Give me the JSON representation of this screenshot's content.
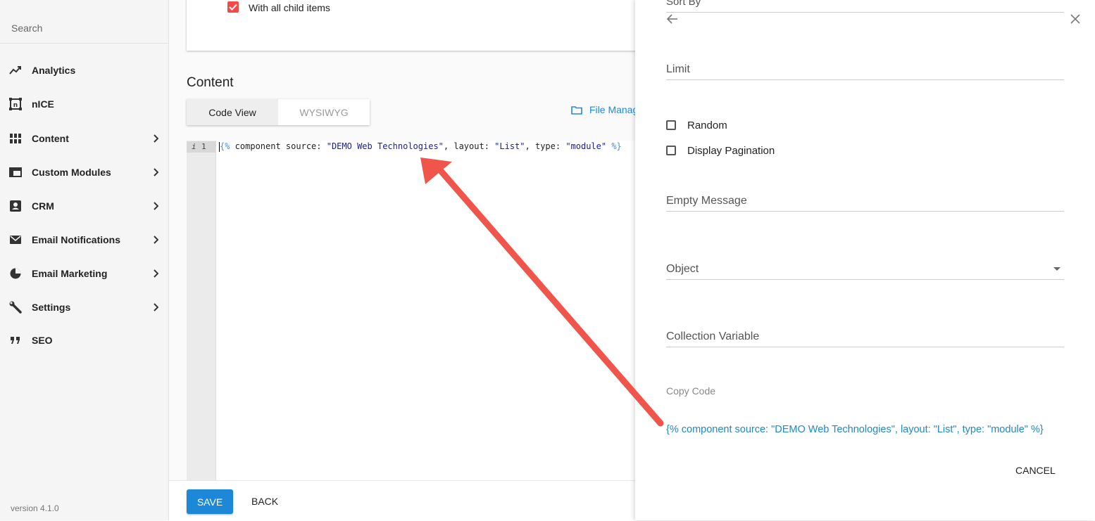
{
  "sidebar": {
    "search_placeholder": "Search",
    "items": [
      {
        "label": "Analytics",
        "icon": "trending-up-icon",
        "has_chevron": false
      },
      {
        "label": "nICE",
        "icon": "nice-icon",
        "has_chevron": false
      },
      {
        "label": "Content",
        "icon": "grid-icon",
        "has_chevron": true
      },
      {
        "label": "Custom Modules",
        "icon": "modules-icon",
        "has_chevron": true
      },
      {
        "label": "CRM",
        "icon": "contact-card-icon",
        "has_chevron": true
      },
      {
        "label": "Email Notifications",
        "icon": "envelope-icon",
        "has_chevron": true
      },
      {
        "label": "Email Marketing",
        "icon": "pie-chart-icon",
        "has_chevron": true
      },
      {
        "label": "Settings",
        "icon": "wrench-icon",
        "has_chevron": true
      },
      {
        "label": "SEO",
        "icon": "quote-icon",
        "has_chevron": false
      }
    ],
    "version": "version 4.1.0"
  },
  "main": {
    "child_items_label": "With all child items",
    "child_items_checked": true,
    "content_title": "Content",
    "tabs": [
      {
        "label": "Code View",
        "active": true
      },
      {
        "label": "WYSIWYG",
        "active": false
      }
    ],
    "file_manager_label": "File Manag",
    "editor": {
      "line_info": "i",
      "line_number": "1",
      "code": "{% component source: \"DEMO Web Technologies\", layout: \"List\", type: \"module\" %}",
      "tokens": {
        "open": "{%",
        "t1": " component source: ",
        "s1": "\"DEMO Web Technologies\"",
        "t2": ", layout: ",
        "s2": "\"List\"",
        "t3": ", type: ",
        "s3": "\"module\"",
        "close": " %}"
      }
    },
    "save_label": "SAVE",
    "back_label": "BACK"
  },
  "panel": {
    "sort_by_label": "Sort By",
    "limit_label": "Limit",
    "random_label": "Random",
    "random_checked": false,
    "pagination_label": "Display Pagination",
    "pagination_checked": false,
    "empty_message_label": "Empty Message",
    "object_label": "Object",
    "collection_variable_label": "Collection Variable",
    "copy_code_label": "Copy Code",
    "copy_code_value": "{% component source: \"DEMO Web Technologies\", layout: \"List\", type: \"module\" %}",
    "cancel_label": "CANCEL"
  },
  "colors": {
    "accent_blue": "#1e88d8",
    "checkbox_red": "#f04b4b",
    "annotation_arrow": "#f0554b"
  }
}
